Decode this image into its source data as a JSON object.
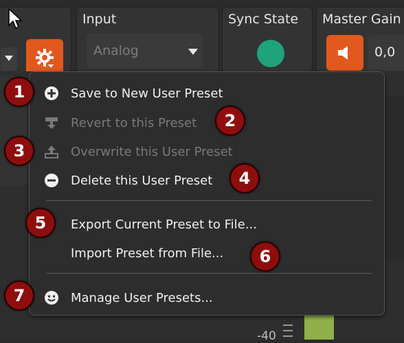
{
  "toolbar": {
    "input_title": "Input",
    "input_value": "Analog",
    "sync_title": "Sync State",
    "sync_color": "#1fa37a",
    "gain_title": "Master Gain",
    "gain_value": "0,0",
    "accent_color": "#e2591e",
    "icons": {
      "cursor": "mouse-pointer-icon",
      "caret": "caret-down-icon",
      "gear": "gear-icon",
      "dropdown": "chevron-down-icon",
      "speaker": "speaker-icon"
    }
  },
  "menu": {
    "items": [
      {
        "label": "Save to New User Preset",
        "icon": "plus-circle-icon",
        "enabled": true
      },
      {
        "label": "Revert to this Preset",
        "icon": "revert-icon",
        "enabled": false
      },
      {
        "label": "Overwrite this User Preset",
        "icon": "overwrite-icon",
        "enabled": false
      },
      {
        "label": "Delete this User Preset",
        "icon": "minus-circle-icon",
        "enabled": true
      },
      {
        "label": "Export Current Preset to File...",
        "icon": "",
        "enabled": true
      },
      {
        "label": "Import Preset from File...",
        "icon": "",
        "enabled": true
      },
      {
        "label": "Manage User Presets...",
        "icon": "smiley-icon",
        "enabled": true
      }
    ]
  },
  "badges": [
    "1",
    "2",
    "3",
    "4",
    "5",
    "6",
    "7"
  ],
  "background": {
    "meter_label": "-40",
    "meter_color": "#8fb04a"
  }
}
